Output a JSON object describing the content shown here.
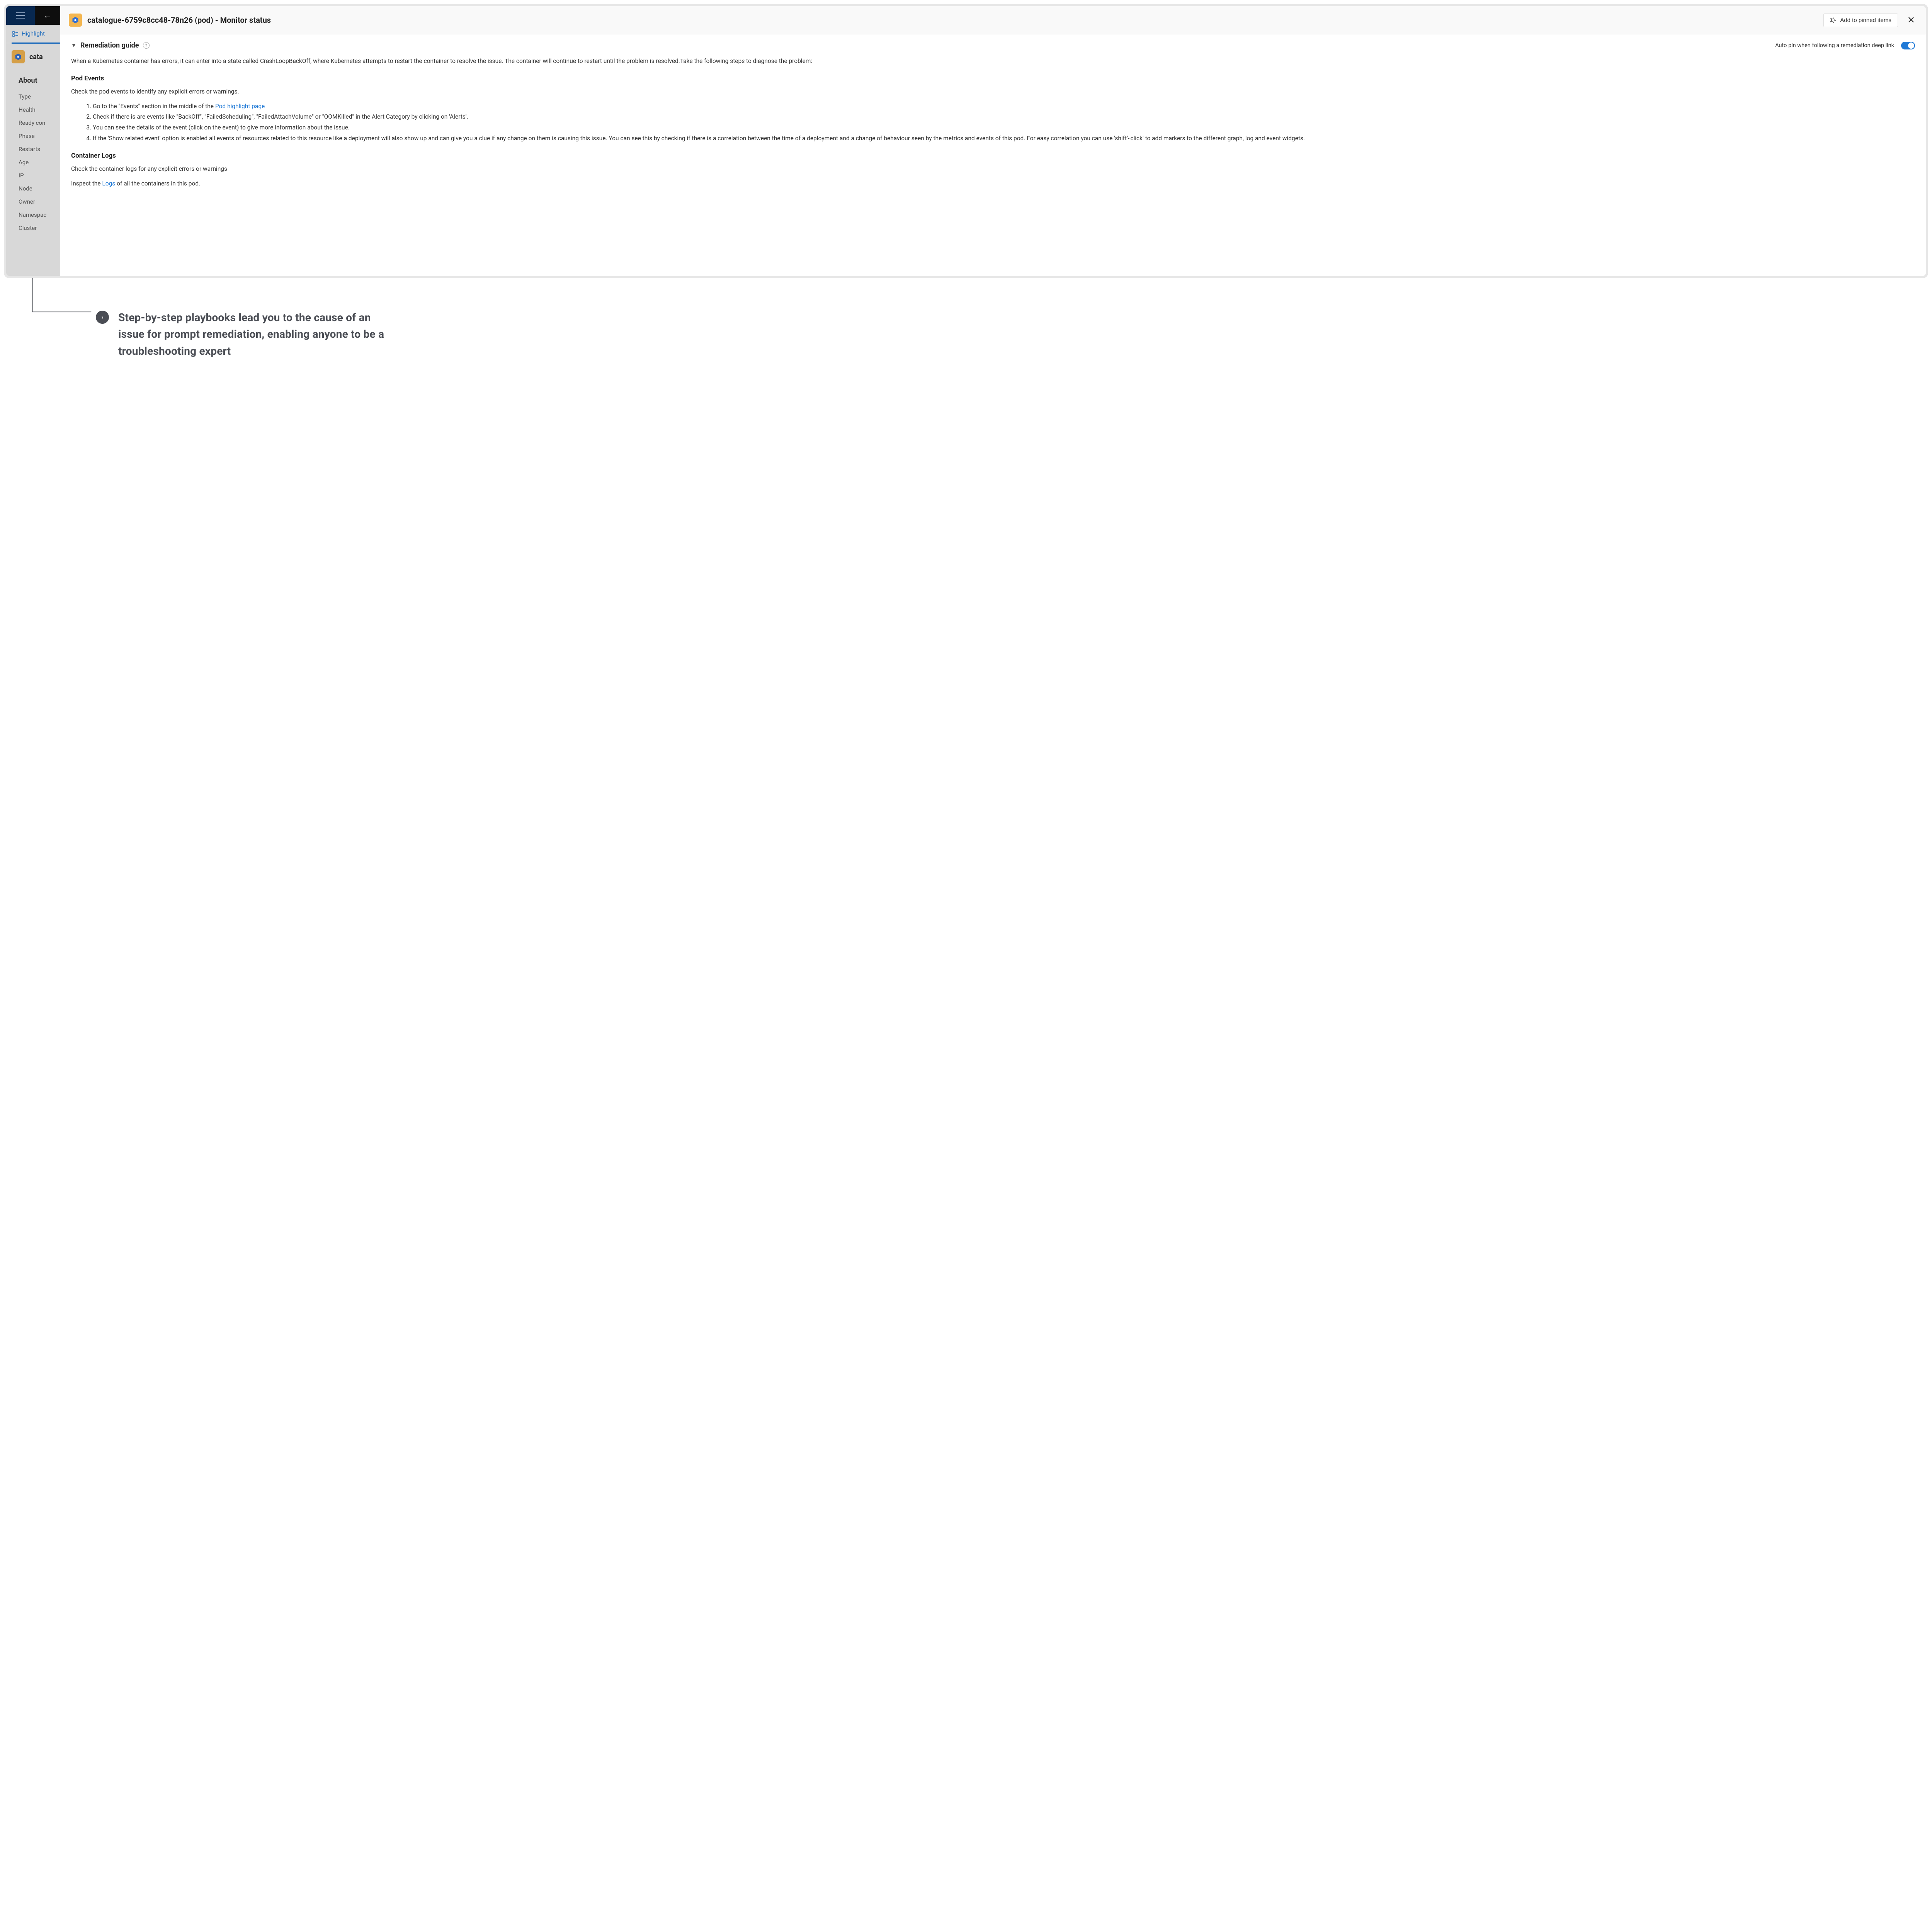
{
  "sidebar": {
    "tab_label": "Highlight",
    "entity_short": "cata",
    "about_heading": "About",
    "items": [
      "Type",
      "Health",
      "Ready con",
      "Phase",
      "Restarts",
      "Age",
      "IP",
      "Node",
      "Owner",
      "Namespac",
      "Cluster"
    ]
  },
  "panel": {
    "title": "catalogue-6759c8cc48-78n26 (pod) - Monitor status",
    "pin_button": "Add to pinned items",
    "guide_title": "Remediation guide",
    "autopin_label": "Auto pin when following a remediation deep link",
    "intro": "When a Kubernetes container has errors, it can enter into a state called CrashLoopBackOff, where Kubernetes attempts to restart the container to resolve the issue. The container will continue to restart until the problem is resolved.Take the following steps to diagnose the problem:",
    "pod_events_h": "Pod Events",
    "pod_events_p": "Check the pod events to identify any explicit errors or warnings.",
    "steps": {
      "s1_a": "Go to the \"Events\" section in the middle of the ",
      "s1_link": "Pod highlight page",
      "s2": "Check if there is are events like \"BackOff\", \"FailedScheduling\", \"FailedAttachVolume\" or \"OOMKilled\" in the Alert Category by clicking on 'Alerts'.",
      "s3": "You can see the details of the event (click on the event) to give more information about the issue.",
      "s4": "If the 'Show related event' option is enabled all events of resources related to this resource like a deployment will also show up and can give you a clue if any change on them is causing this issue. You can see this by checking if there is a correlation between the time of a deployment and a change of behaviour seen by the metrics and events of this pod. For easy correlation you can use 'shift'-'click' to add markers to the different graph, log and event widgets."
    },
    "logs_h": "Container Logs",
    "logs_p": "Check the container logs for any explicit errors or warnings",
    "logs_inspect_a": "Inspect the ",
    "logs_inspect_link": "Logs",
    "logs_inspect_b": " of all the containers in this pod."
  },
  "annotation": {
    "text": "Step-by-step playbooks lead you to the cause of an issue for prompt remediation, enabling anyone to be a troubleshooting expert"
  }
}
